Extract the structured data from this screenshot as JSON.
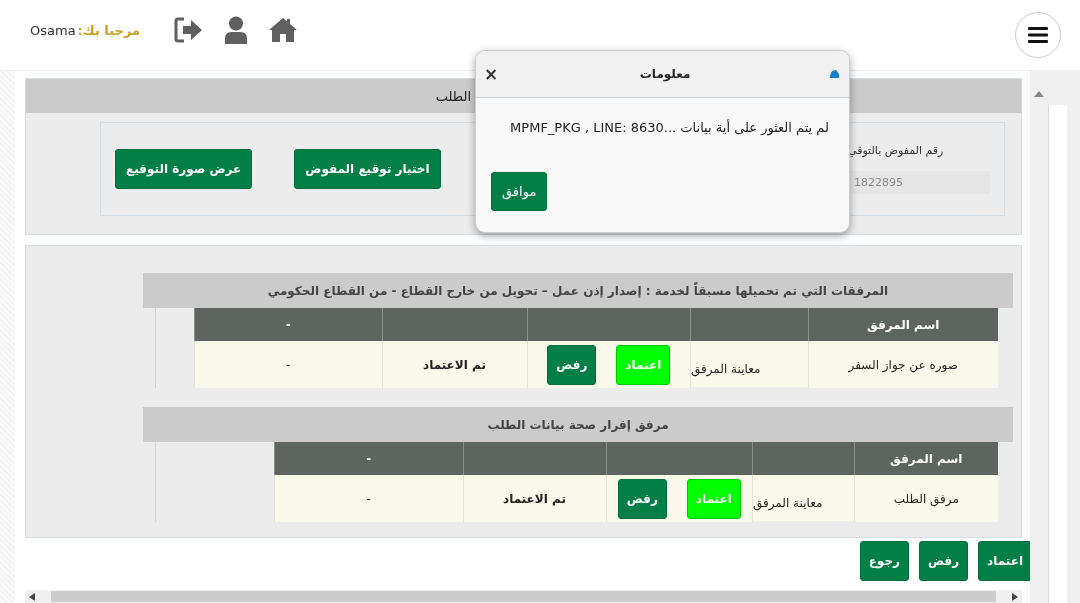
{
  "header": {
    "greeting": "مرحبا بك:",
    "user_name": "Osama"
  },
  "signature_panel": {
    "title": "الطلب",
    "field_label": "رقم المفوض بالتوقي",
    "field_value": "1822895",
    "buttons": [
      "اختيار توقيع المفوض",
      "عرض صورة التوقيع"
    ]
  },
  "sections": [
    {
      "title": "المرفقات التي تم تحميلها مسبقاً لخدمة : إصدار إذن عمل – تحويل من خارج القطاع - من القطاع الحكومي",
      "columns": [
        "اسم المرفق",
        "",
        "",
        "",
        "-"
      ],
      "rows": [
        {
          "name": "صوره عن جواز السفر",
          "preview": "معاينة المرفق",
          "approve": "اعتماد",
          "reject": "رفض",
          "status": "تم الاعتماد",
          "note": "-"
        }
      ]
    },
    {
      "title": "مرفق إقرار صحة بيانات الطلب",
      "columns": [
        "اسم المرفق",
        "",
        "",
        "",
        "-"
      ],
      "rows": [
        {
          "name": "مرفق الطلب",
          "preview": "معاينة المرفق",
          "approve": "اعتماد",
          "reject": "رفض",
          "status": "تم الاعتماد",
          "note": "-"
        }
      ]
    }
  ],
  "actions": [
    "اعتماد",
    "رفض",
    "رجوع"
  ],
  "dialog": {
    "title": "معلومات",
    "message": "لم يتم العثور على أية بيانات ...MPMF_PKG , LINE: 8630",
    "button": "موافق",
    "close": "×"
  }
}
